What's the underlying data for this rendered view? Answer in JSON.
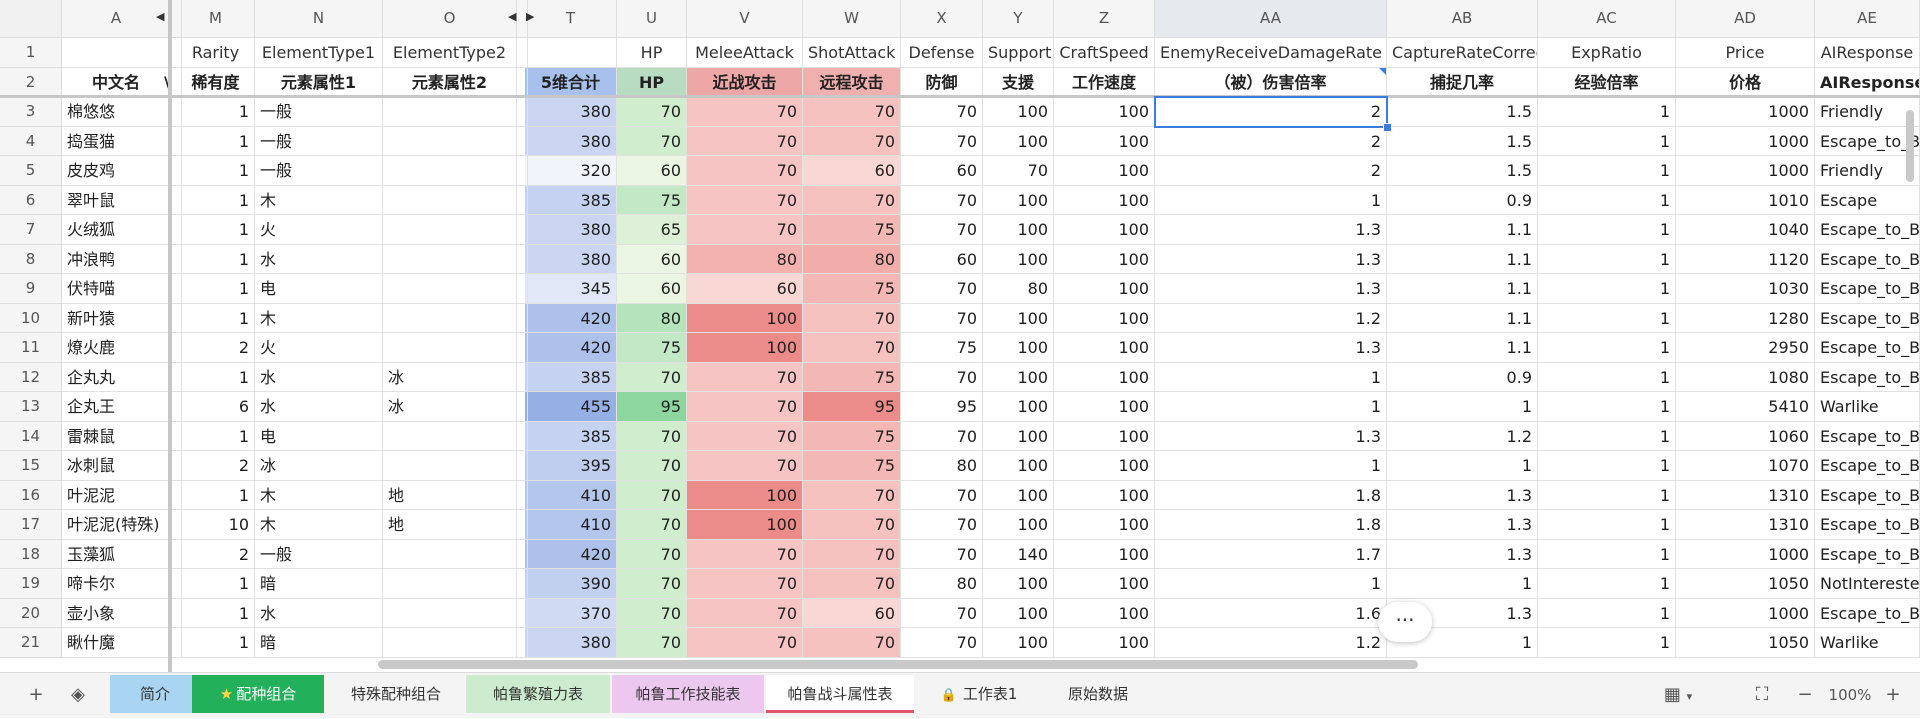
{
  "column_headers": [
    "A",
    "M",
    "N",
    "O",
    "T",
    "U",
    "V",
    "W",
    "X",
    "Y",
    "Z",
    "AA",
    "AB",
    "AC",
    "AD",
    "AE"
  ],
  "header_row_1": [
    "",
    "Rarity",
    "ElementType1",
    "ElementType2",
    "",
    "HP",
    "MeleeAttack",
    "ShotAttack",
    "Defense",
    "Support",
    "CraftSpeed",
    "EnemyReceiveDamageRate",
    "CaptureRateCorrect",
    "ExpRatio",
    "Price",
    "AIResponse"
  ],
  "header_row_2": [
    "中文名",
    "稀有度",
    "元素属性1",
    "元素属性2",
    "5维合计",
    "HP",
    "近战攻击",
    "远程攻击",
    "防御",
    "支援",
    "工作速度",
    "（被）伤害倍率",
    "捕捉几率",
    "经验倍率",
    "价格",
    "AIResponse"
  ],
  "hidden_col_marker": "\\",
  "row_numbers": [
    "1",
    "2",
    "3",
    "4",
    "5",
    "6",
    "7",
    "8",
    "9",
    "10",
    "11",
    "12",
    "13",
    "14",
    "15",
    "16",
    "17",
    "18",
    "19",
    "20",
    "21"
  ],
  "rows": [
    [
      "棉悠悠",
      "1",
      "一般",
      "",
      "380",
      "70",
      "70",
      "70",
      "70",
      "100",
      "100",
      "2",
      "1.5",
      "1",
      "1000",
      "Friendly"
    ],
    [
      "捣蛋猫",
      "1",
      "一般",
      "",
      "380",
      "70",
      "70",
      "70",
      "70",
      "100",
      "100",
      "2",
      "1.5",
      "1",
      "1000",
      "Escape_to_B"
    ],
    [
      "皮皮鸡",
      "1",
      "一般",
      "",
      "320",
      "60",
      "70",
      "60",
      "60",
      "70",
      "100",
      "2",
      "1.5",
      "1",
      "1000",
      "Friendly"
    ],
    [
      "翠叶鼠",
      "1",
      "木",
      "",
      "385",
      "75",
      "70",
      "70",
      "70",
      "100",
      "100",
      "1",
      "0.9",
      "1",
      "1010",
      "Escape"
    ],
    [
      "火绒狐",
      "1",
      "火",
      "",
      "380",
      "65",
      "70",
      "75",
      "70",
      "100",
      "100",
      "1.3",
      "1.1",
      "1",
      "1040",
      "Escape_to_B"
    ],
    [
      "冲浪鸭",
      "1",
      "水",
      "",
      "380",
      "60",
      "80",
      "80",
      "60",
      "100",
      "100",
      "1.3",
      "1.1",
      "1",
      "1120",
      "Escape_to_B"
    ],
    [
      "伏特喵",
      "1",
      "电",
      "",
      "345",
      "60",
      "60",
      "75",
      "70",
      "80",
      "100",
      "1.3",
      "1.1",
      "1",
      "1030",
      "Escape_to_B"
    ],
    [
      "新叶猿",
      "1",
      "木",
      "",
      "420",
      "80",
      "100",
      "70",
      "70",
      "100",
      "100",
      "1.2",
      "1.1",
      "1",
      "1280",
      "Escape_to_B"
    ],
    [
      "燎火鹿",
      "2",
      "火",
      "",
      "420",
      "75",
      "100",
      "70",
      "75",
      "100",
      "100",
      "1.3",
      "1.1",
      "1",
      "2950",
      "Escape_to_B"
    ],
    [
      "企丸丸",
      "1",
      "水",
      "冰",
      "385",
      "70",
      "70",
      "75",
      "70",
      "100",
      "100",
      "1",
      "0.9",
      "1",
      "1080",
      "Escape_to_B"
    ],
    [
      "企丸王",
      "6",
      "水",
      "冰",
      "455",
      "95",
      "70",
      "95",
      "95",
      "100",
      "100",
      "1",
      "1",
      "1",
      "5410",
      "Warlike"
    ],
    [
      "雷棘鼠",
      "1",
      "电",
      "",
      "385",
      "70",
      "70",
      "75",
      "70",
      "100",
      "100",
      "1.3",
      "1.2",
      "1",
      "1060",
      "Escape_to_B"
    ],
    [
      "冰刺鼠",
      "2",
      "冰",
      "",
      "395",
      "70",
      "70",
      "75",
      "80",
      "100",
      "100",
      "1",
      "1",
      "1",
      "1070",
      "Escape_to_B"
    ],
    [
      "叶泥泥",
      "1",
      "木",
      "地",
      "410",
      "70",
      "100",
      "70",
      "70",
      "100",
      "100",
      "1.8",
      "1.3",
      "1",
      "1310",
      "Escape_to_B"
    ],
    [
      "叶泥泥(特殊)",
      "10",
      "木",
      "地",
      "410",
      "70",
      "100",
      "70",
      "70",
      "100",
      "100",
      "1.8",
      "1.3",
      "1",
      "1310",
      "Escape_to_B"
    ],
    [
      "玉藻狐",
      "2",
      "一般",
      "",
      "420",
      "70",
      "70",
      "70",
      "70",
      "140",
      "100",
      "1.7",
      "1.3",
      "1",
      "1000",
      "Escape_to_B"
    ],
    [
      "啼卡尔",
      "1",
      "暗",
      "",
      "390",
      "70",
      "70",
      "70",
      "80",
      "100",
      "100",
      "1",
      "1",
      "1",
      "1050",
      "NotInteresteḍ"
    ],
    [
      "壶小象",
      "1",
      "水",
      "",
      "370",
      "70",
      "70",
      "60",
      "70",
      "100",
      "100",
      "1.6",
      "1.3",
      "1",
      "1000",
      "Escape_to_B"
    ],
    [
      "瞅什魔",
      "1",
      "暗",
      "",
      "380",
      "70",
      "70",
      "70",
      "70",
      "100",
      "100",
      "1.2",
      "1",
      "1",
      "1050",
      "Warlike"
    ]
  ],
  "sheet_tabs": [
    {
      "label": "简介",
      "bg": "#a9d4f2"
    },
    {
      "label": "配种组合",
      "bg": "#22b05a",
      "starred": true
    },
    {
      "label": "特殊配种组合",
      "bg": "#f4f4f4"
    },
    {
      "label": "帕鲁繁殖力表",
      "bg": "#cdeccf"
    },
    {
      "label": "帕鲁工作技能表",
      "bg": "#ecc8ef"
    },
    {
      "label": "帕鲁战斗属性表",
      "bg": "#ffffff",
      "active": true
    },
    {
      "label": "工作表1",
      "bg": "#f4f4f4",
      "locked": true
    },
    {
      "label": "原始数据",
      "bg": "#f4f4f4"
    }
  ],
  "zoom": "100%",
  "icons": {
    "add": "+",
    "layers": "◈",
    "grid": "▦",
    "fit": "⛶",
    "minus": "−",
    "plus": "+",
    "more": "···",
    "lock": "🔒",
    "star": "★"
  },
  "colors": {
    "accent": "#3c7be0",
    "active_tab_underline": "#e0556a"
  }
}
